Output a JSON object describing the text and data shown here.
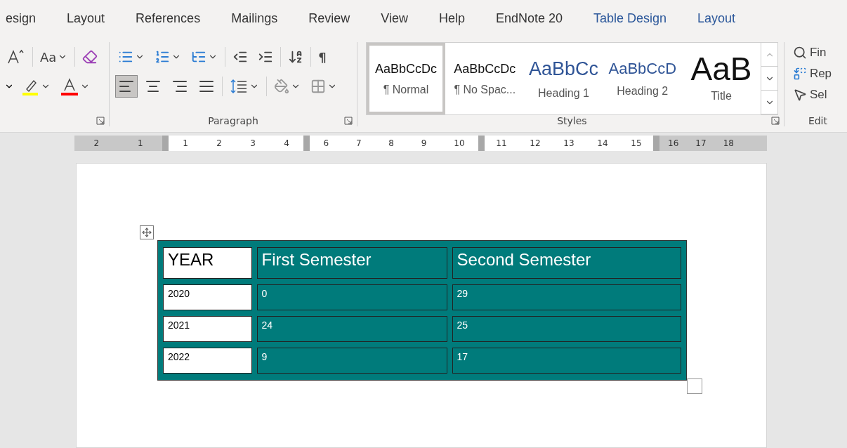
{
  "ribbon_tabs": [
    {
      "label": "esign",
      "kind": "normal"
    },
    {
      "label": "Layout",
      "kind": "normal"
    },
    {
      "label": "References",
      "kind": "normal"
    },
    {
      "label": "Mailings",
      "kind": "normal"
    },
    {
      "label": "Review",
      "kind": "normal"
    },
    {
      "label": "View",
      "kind": "normal"
    },
    {
      "label": "Help",
      "kind": "normal"
    },
    {
      "label": "EndNote 20",
      "kind": "normal"
    },
    {
      "label": "Table Design",
      "kind": "contextual"
    },
    {
      "label": "Layout",
      "kind": "contextual"
    }
  ],
  "font_group": {
    "change_case": "Aa"
  },
  "paragraph_group": {
    "label": "Paragraph",
    "show_marks": "¶",
    "alignments": [
      {
        "kind": "left",
        "selected": true
      },
      {
        "kind": "center",
        "selected": false
      },
      {
        "kind": "right",
        "selected": false
      },
      {
        "kind": "justify",
        "selected": false
      }
    ]
  },
  "styles_group": {
    "label": "Styles",
    "styles": [
      {
        "sample": "AaBbCcDc",
        "name": "¶ Normal",
        "kind": "normal",
        "selected": true
      },
      {
        "sample": "AaBbCcDc",
        "name": "¶ No Spac...",
        "kind": "normal",
        "selected": false
      },
      {
        "sample": "AaBbCc",
        "name": "Heading 1",
        "kind": "heading1",
        "selected": false
      },
      {
        "sample": "AaBbCcD",
        "name": "Heading 2",
        "kind": "heading2",
        "selected": false
      },
      {
        "sample": "AaB",
        "name": "Title",
        "kind": "title",
        "selected": false
      }
    ]
  },
  "editing_group": {
    "label": "Edit",
    "commands": [
      {
        "kind": "find",
        "label": "Fin"
      },
      {
        "kind": "replace",
        "label": "Rep"
      },
      {
        "kind": "select",
        "label": "Sel"
      }
    ]
  },
  "ruler": {
    "segments": [
      {
        "kind": "margin",
        "numbers": [
          "2",
          "1"
        ]
      },
      {
        "kind": "text",
        "numbers": [
          "1",
          "2",
          "3",
          "4"
        ]
      },
      {
        "kind": "text",
        "numbers": [
          "6",
          "7",
          "8",
          "9",
          "10"
        ]
      },
      {
        "kind": "text",
        "numbers": [
          "11",
          "12",
          "13",
          "14",
          "15"
        ]
      },
      {
        "kind": "margin",
        "numbers": [
          "16",
          "17",
          "18"
        ]
      }
    ]
  },
  "table": {
    "rows": [
      {
        "kind": "header",
        "cells": [
          {
            "text": "YEAR",
            "shaded": false
          },
          {
            "text": "First Semester",
            "shaded": true
          },
          {
            "text": "Second Semester",
            "shaded": true
          }
        ]
      },
      {
        "kind": "body",
        "cells": [
          {
            "text": "2020",
            "shaded": false
          },
          {
            "text": "0",
            "shaded": true
          },
          {
            "text": "29",
            "shaded": true
          }
        ]
      },
      {
        "kind": "body",
        "cells": [
          {
            "text": "2021",
            "shaded": false
          },
          {
            "text": "24",
            "shaded": true
          },
          {
            "text": "25",
            "shaded": true
          }
        ]
      },
      {
        "kind": "body",
        "cells": [
          {
            "text": "2022",
            "shaded": false
          },
          {
            "text": "9",
            "shaded": true
          },
          {
            "text": "17",
            "shaded": true
          }
        ]
      }
    ]
  }
}
